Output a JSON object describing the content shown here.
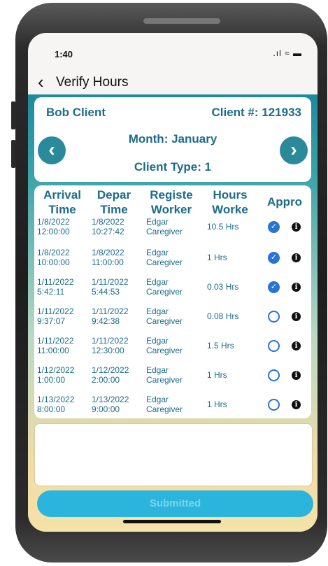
{
  "status": {
    "time": "1:40",
    "icons": ".ıl ≈ ▬"
  },
  "nav": {
    "title": "Verify Hours"
  },
  "client": {
    "name": "Bob Client",
    "number_label": "Client #: 121933",
    "month_label": "Month: January",
    "type_label": "Client Type: 1"
  },
  "table": {
    "headers": [
      {
        "l1": "Arrival",
        "l2": "Time"
      },
      {
        "l1": "Depar",
        "l2": "Time"
      },
      {
        "l1": "Registe",
        "l2": "Worker"
      },
      {
        "l1": "Hours",
        "l2": "Worke"
      },
      {
        "l1": "Appro",
        "l2": ""
      }
    ],
    "rows": [
      {
        "arr_d": "1/8/2022",
        "arr_t": "12:00:00",
        "dep_d": "1/8/2022",
        "dep_t": "10:27:42",
        "w1": "Edgar",
        "w2": "Caregiver",
        "hours": "10.5 Hrs",
        "approved": true
      },
      {
        "arr_d": "1/8/2022",
        "arr_t": "10:00:00",
        "dep_d": "1/8/2022",
        "dep_t": "11:00:00",
        "w1": "Edgar",
        "w2": "Caregiver",
        "hours": "1 Hrs",
        "approved": true
      },
      {
        "arr_d": "1/11/2022",
        "arr_t": "5:42:11",
        "dep_d": "1/11/2022",
        "dep_t": "5:44:53",
        "w1": "Edgar",
        "w2": "Caregiver",
        "hours": "0.03 Hrs",
        "approved": true
      },
      {
        "arr_d": "1/11/2022",
        "arr_t": "9:37:07",
        "dep_d": "1/11/2022",
        "dep_t": "9:42:38",
        "w1": "Edgar",
        "w2": "Caregiver",
        "hours": "0.08 Hrs",
        "approved": false
      },
      {
        "arr_d": "1/11/2022",
        "arr_t": "11:00:00",
        "dep_d": "1/11/2022",
        "dep_t": "12:30:00",
        "w1": "Edgar",
        "w2": "Caregiver",
        "hours": "1.5 Hrs",
        "approved": false
      },
      {
        "arr_d": "1/12/2022",
        "arr_t": "1:00:00",
        "dep_d": "1/12/2022",
        "dep_t": "2:00:00",
        "w1": "Edgar",
        "w2": "Caregiver",
        "hours": "1 Hrs",
        "approved": false
      },
      {
        "arr_d": "1/13/2022",
        "arr_t": "8:00:00",
        "dep_d": "1/13/2022",
        "dep_t": "9:00:00",
        "w1": "Edgar",
        "w2": "Caregiver",
        "hours": "1 Hrs",
        "approved": false
      }
    ]
  },
  "notes": {
    "value": ""
  },
  "submit": {
    "label": "Submitted"
  },
  "icons": {
    "back": "chevron-left-icon",
    "prev": "chevron-left-circle-icon",
    "next": "chevron-right-circle-icon",
    "approved": "check-circle-icon",
    "info": "info-icon"
  },
  "colors": {
    "accent": "#1c6c8a",
    "button": "#2b8a99",
    "check": "#2a72d6",
    "submit": "#2bb5dc"
  }
}
